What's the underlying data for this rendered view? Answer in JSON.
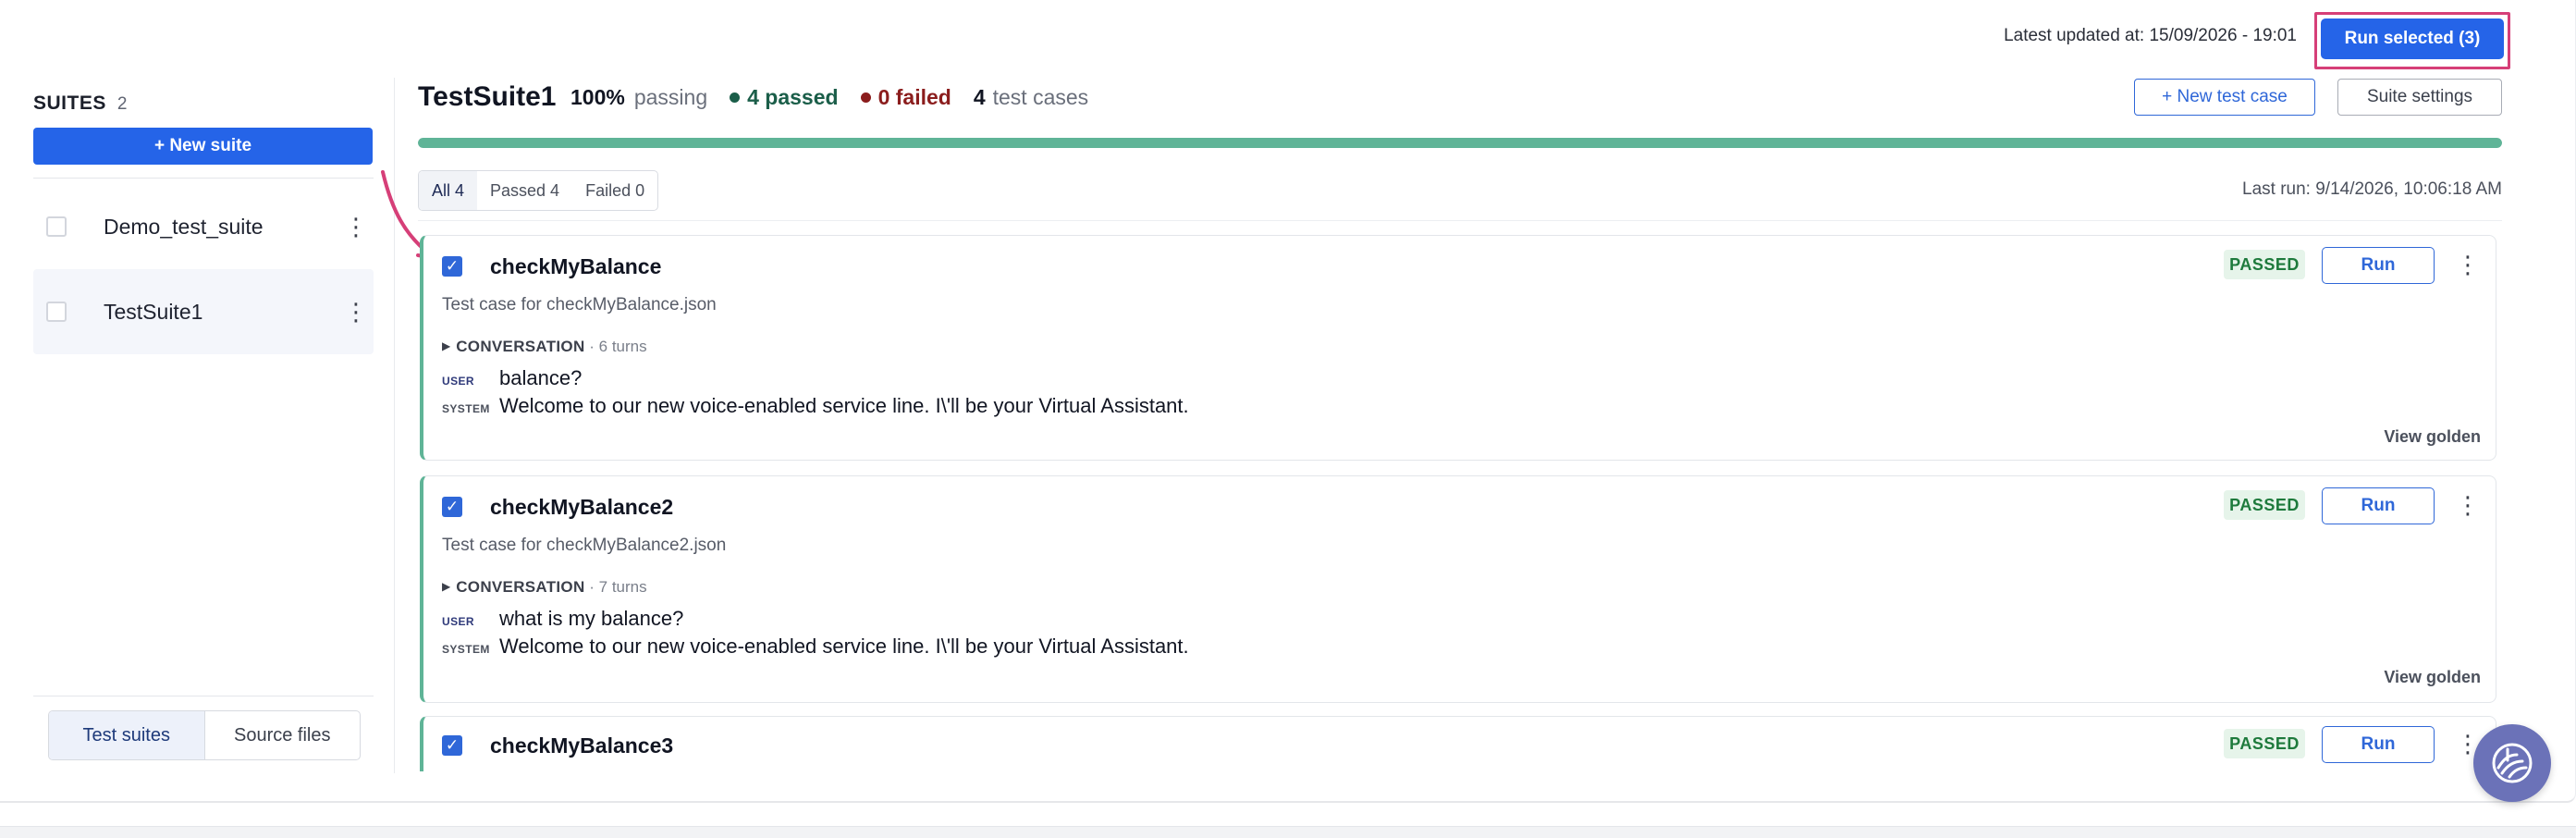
{
  "header": {
    "latest_updated": "Latest updated at: 15/09/2026 - 19:01",
    "run_selected_label": "Run selected (3)"
  },
  "sidebar": {
    "title": "SUITES",
    "count": "2",
    "new_suite_label": "+ New suite",
    "suites": [
      {
        "name": "Demo_test_suite",
        "active": false
      },
      {
        "name": "TestSuite1",
        "active": true
      }
    ],
    "tabs": [
      {
        "label": "Test suites",
        "active": true
      },
      {
        "label": "Source files",
        "active": false
      }
    ]
  },
  "main": {
    "suite_title": "TestSuite1",
    "pass_pct": "100%",
    "passing_label": "passing",
    "passed_text": "4 passed",
    "failed_text": "0 failed",
    "cases_count": "4",
    "cases_label": "test cases",
    "new_test_case_label": "+ New test case",
    "suite_settings_label": "Suite settings",
    "progress_fraction": 1.0,
    "filters": [
      {
        "label": "All 4",
        "active": true
      },
      {
        "label": "Passed 4",
        "active": false
      },
      {
        "label": "Failed 0",
        "active": false
      }
    ],
    "last_run": "Last run: 9/14/2026, 10:06:18 AM"
  },
  "test_cases": [
    {
      "title": "checkMyBalance",
      "subtitle": "Test case for checkMyBalance.json",
      "status": "PASSED",
      "run_label": "Run",
      "conversation_label": "CONVERSATION",
      "turns": "· 6 turns",
      "user_role": "USER",
      "user_msg": "balance?",
      "system_role": "SYSTEM",
      "system_msg": "Welcome to our new voice-enabled service line. I\\'ll be your Virtual Assistant.",
      "view_golden": "View golden"
    },
    {
      "title": "checkMyBalance2",
      "subtitle": "Test case for checkMyBalance2.json",
      "status": "PASSED",
      "run_label": "Run",
      "conversation_label": "CONVERSATION",
      "turns": "· 7 turns",
      "user_role": "USER",
      "user_msg": "what is my balance?",
      "system_role": "SYSTEM",
      "system_msg": "Welcome to our new voice-enabled service line. I\\'ll be your Virtual Assistant.",
      "view_golden": "View golden"
    },
    {
      "title": "checkMyBalance3",
      "status": "PASSED",
      "run_label": "Run"
    }
  ],
  "colors": {
    "primary": "#2564e8",
    "passed_green": "#5fb497",
    "failed_red": "#8b1d1d",
    "highlight_pink": "#d63f78",
    "assistant_purple": "#6b72b8"
  },
  "icons": [
    "kebab-menu-icon",
    "checkbox-checked-icon",
    "caret-right-icon",
    "annotation-arrow-icon",
    "assistant-icon"
  ]
}
